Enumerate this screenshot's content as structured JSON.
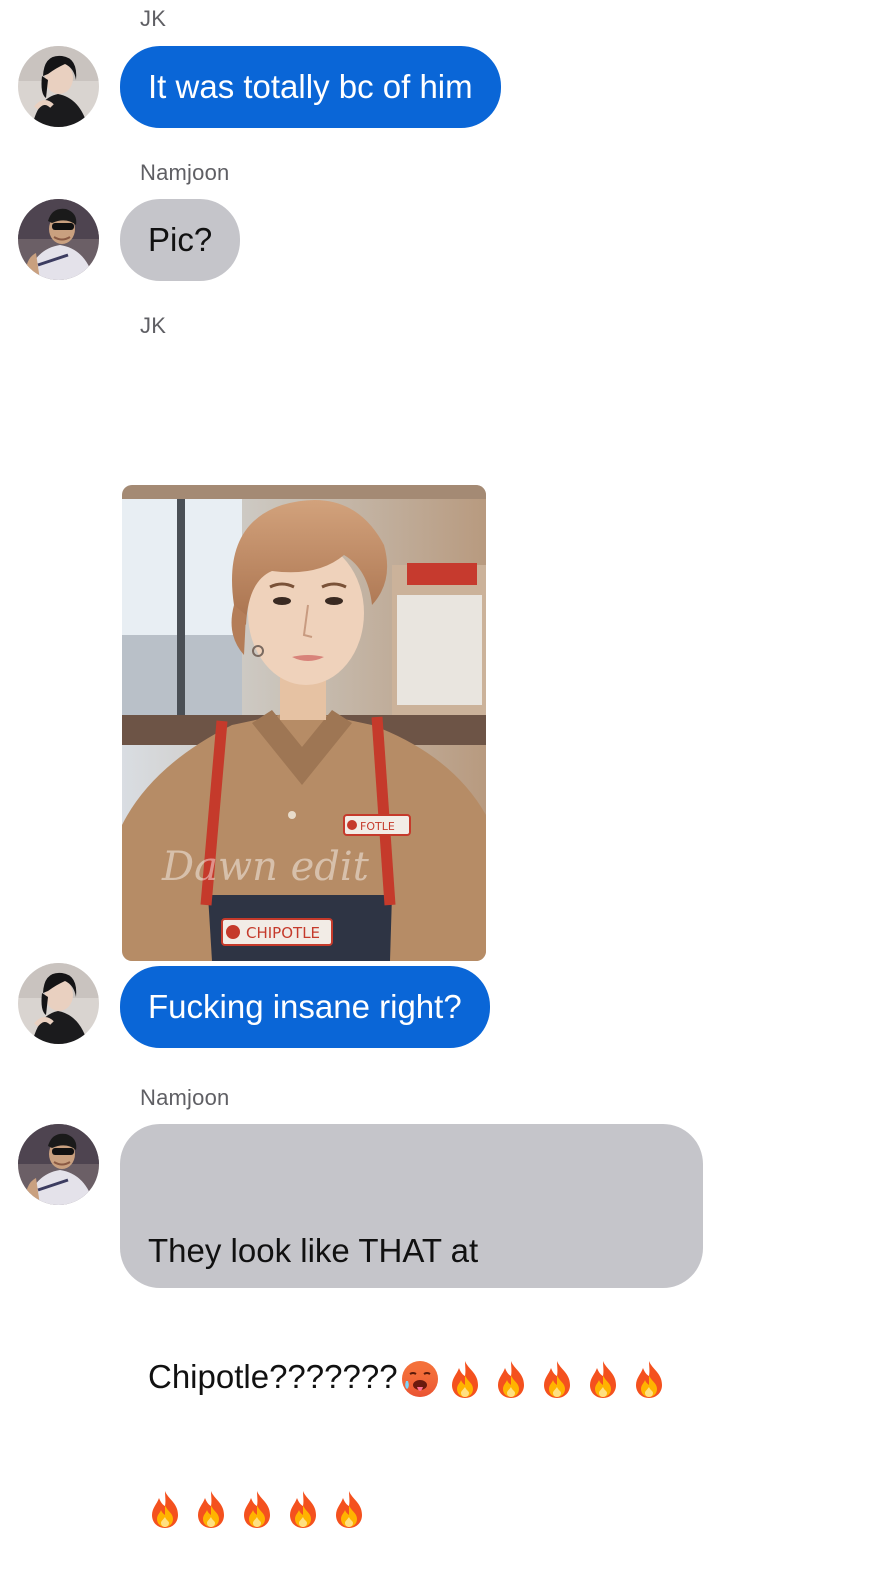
{
  "messages": [
    {
      "sender": "JK",
      "text": "It was totally bc of him"
    },
    {
      "sender": "Namjoon",
      "text": "Pic?"
    },
    {
      "sender": "JK",
      "image": "photo-young-man-in-chipotle-uniform",
      "text": "Fucking insane right?"
    },
    {
      "sender": "Namjoon",
      "text_line1": "They look like THAT at",
      "text_line2": "Chipotle???????"
    }
  ],
  "photo": {
    "apron_logo_text": "CHIPOTLE",
    "shirt_logo_text": "FOTLE",
    "watermark": "Dawn edit"
  },
  "emoji": {
    "hot_face": "hot-face-emoji",
    "fire": "fire-emoji",
    "fire_count_line2": 5,
    "fire_count_line3": 5
  },
  "colors": {
    "outgoing_bubble": "#0a66d7",
    "incoming_bubble": "#c5c5ca",
    "sender_label": "#5f5f64"
  }
}
